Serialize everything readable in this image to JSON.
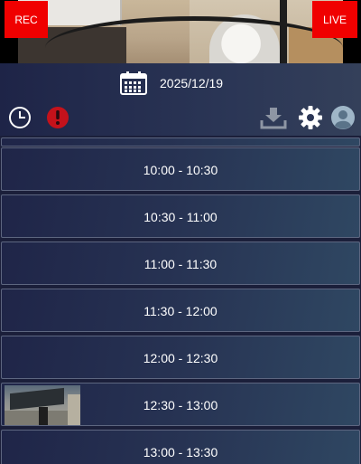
{
  "header": {
    "rec_label": "REC",
    "live_label": "LIVE",
    "date": "2025/12/19",
    "calendar_icon": "calendar-icon"
  },
  "toolbar": {
    "icons": [
      "clock-icon",
      "alert-icon",
      "download-icon",
      "gear-icon",
      "avatar-icon"
    ]
  },
  "colors": {
    "accent_red": "#f00000",
    "bar_dark": "#1e2447",
    "alert_red": "#c4121b"
  },
  "recordings": [
    {
      "time": "10:00 - 10:30",
      "has_thumbnail": false
    },
    {
      "time": "10:30 - 11:00",
      "has_thumbnail": false
    },
    {
      "time": "11:00 - 11:30",
      "has_thumbnail": false
    },
    {
      "time": "11:30 - 12:00",
      "has_thumbnail": false
    },
    {
      "time": "12:00 - 12:30",
      "has_thumbnail": false
    },
    {
      "time": "12:30 - 13:00",
      "has_thumbnail": true
    },
    {
      "time": "13:00 - 13:30",
      "has_thumbnail": false
    }
  ]
}
